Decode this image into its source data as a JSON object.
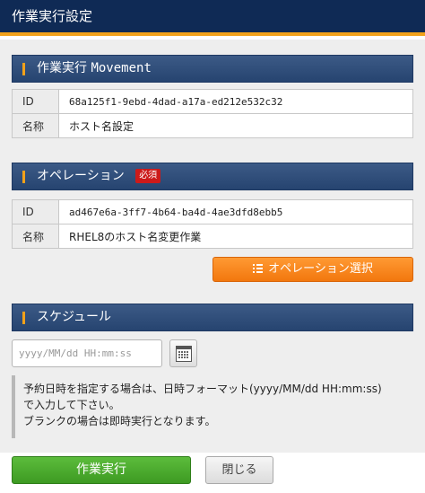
{
  "window": {
    "title": "作業実行設定"
  },
  "movement": {
    "heading_prefix": "作業実行",
    "heading_suffix": "Movement",
    "rows": [
      {
        "key": "ID",
        "value": "68a125f1-9ebd-4dad-a17a-ed212e532c32"
      },
      {
        "key": "名称",
        "value": "ホスト名設定"
      }
    ]
  },
  "operation": {
    "heading": "オペレーション",
    "required_badge": "必須",
    "rows": [
      {
        "key": "ID",
        "value": "ad467e6a-3ff7-4b64-ba4d-4ae3dfd8ebb5"
      },
      {
        "key": "名称",
        "value": "RHEL8のホスト名変更作業"
      }
    ],
    "select_button": "オペレーション選択",
    "select_button_icon": "list-icon"
  },
  "schedule": {
    "heading": "スケジュール",
    "input_value": "",
    "input_placeholder": "yyyy/MM/dd HH:mm:ss",
    "calendar_icon": "calendar-icon",
    "note_lines": [
      "予約日時を指定する場合は、日時フォーマット(yyyy/MM/dd HH:mm:ss)",
      "で入力して下さい。",
      "ブランクの場合は即時実行となります。"
    ]
  },
  "footer": {
    "run_button": "作業実行",
    "close_button": "閉じる"
  },
  "colors": {
    "title_bg": "#0f2a55",
    "accent_orange": "#f2a11a",
    "section_header": "#2f4e7c",
    "required_red": "#cc1a1a",
    "operation_button": "#f7861b",
    "run_button": "#4aab2d"
  }
}
